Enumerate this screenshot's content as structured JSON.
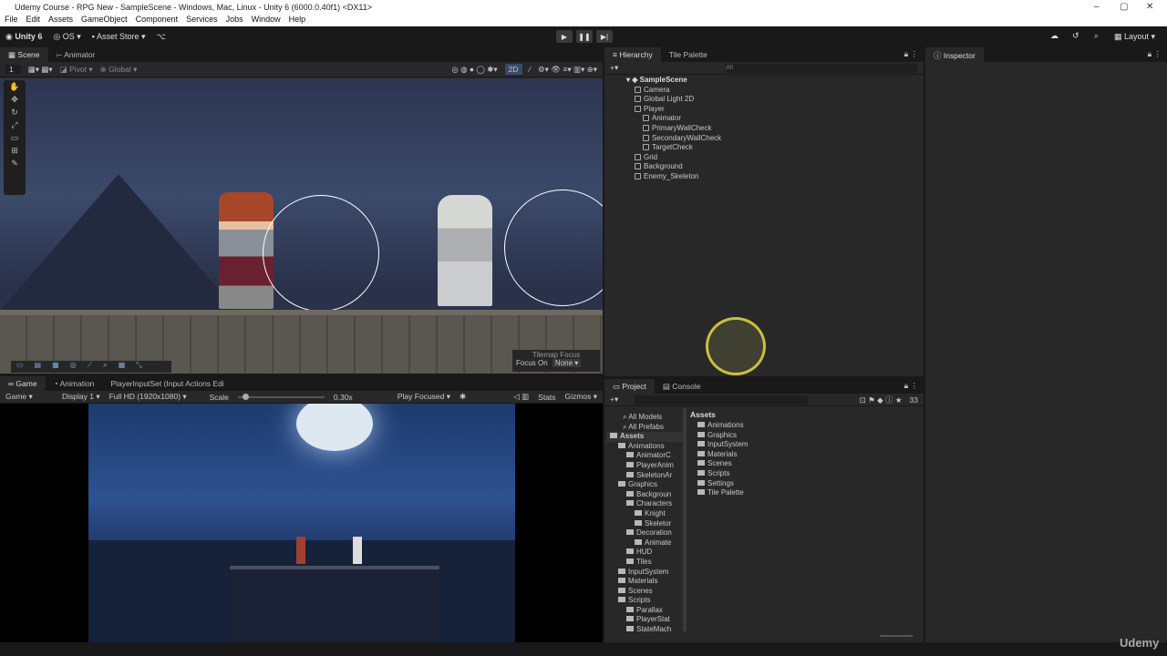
{
  "window": {
    "title": "Udemy Course - RPG New - SampleScene - Windows, Mac, Linux - Unity 6 (6000.0.40f1) <DX11>"
  },
  "menu": [
    "File",
    "Edit",
    "Assets",
    "GameObject",
    "Component",
    "Services",
    "Jobs",
    "Window",
    "Help"
  ],
  "toolbar": {
    "account": "Unity 6",
    "os": "OS",
    "asset_store": "Asset Store",
    "layout": "Layout"
  },
  "scene": {
    "tabs": [
      "Scene",
      "Animator"
    ],
    "layer": "1",
    "pivot": "Pivot",
    "global": "Global",
    "mode2d": "2D",
    "overlay_title": "Tilemap Focus",
    "focus_label": "Focus On",
    "focus_value": "None"
  },
  "game": {
    "tabs": [
      "Game",
      "Animation",
      "PlayerInputSet (Input Actions Edi"
    ],
    "mode": "Game",
    "display": "Display 1",
    "resolution": "Full HD (1920x1080)",
    "scale_label": "Scale",
    "scale_value": "0.30x",
    "scale_fraction": 0.05,
    "play_focused": "Play Focused",
    "stats": "Stats",
    "gizmos": "Gizmos"
  },
  "hierarchy": {
    "tabs": [
      "Hierarchy",
      "Tile Palette"
    ],
    "search_placeholder": "All",
    "scene": "SampleScene",
    "items": [
      {
        "label": "Camera",
        "depth": 1
      },
      {
        "label": "Global Light 2D",
        "depth": 1
      },
      {
        "label": "Player",
        "depth": 1
      },
      {
        "label": "Animator",
        "depth": 2
      },
      {
        "label": "PrimaryWallCheck",
        "depth": 2
      },
      {
        "label": "SecondaryWallCheck",
        "depth": 2
      },
      {
        "label": "TargetCheck",
        "depth": 2
      },
      {
        "label": "Grid",
        "depth": 1
      },
      {
        "label": "Background",
        "depth": 1
      },
      {
        "label": "Enemy_Skeleton",
        "depth": 1
      }
    ]
  },
  "inspector": {
    "tab": "Inspector"
  },
  "project": {
    "tabs": [
      "Project",
      "Console"
    ],
    "hidden_count": "33",
    "breadcrumb": "Assets",
    "tree": [
      {
        "label": "All Models",
        "depth": 0
      },
      {
        "label": "All Prefabs",
        "depth": 0
      },
      {
        "label": "Assets",
        "depth": 0
      },
      {
        "label": "Animations",
        "depth": 1
      },
      {
        "label": "AnimatorC",
        "depth": 2
      },
      {
        "label": "PlayerAnim",
        "depth": 2
      },
      {
        "label": "SkeletonAr",
        "depth": 2
      },
      {
        "label": "Graphics",
        "depth": 1
      },
      {
        "label": "Backgroun",
        "depth": 2
      },
      {
        "label": "Characters",
        "depth": 2
      },
      {
        "label": "Knight",
        "depth": 3
      },
      {
        "label": "Skeletor",
        "depth": 3
      },
      {
        "label": "Decoration",
        "depth": 2
      },
      {
        "label": "Animate",
        "depth": 3
      },
      {
        "label": "HUD",
        "depth": 2
      },
      {
        "label": "Tiles",
        "depth": 2
      },
      {
        "label": "InputSystem",
        "depth": 1
      },
      {
        "label": "Materials",
        "depth": 1
      },
      {
        "label": "Scenes",
        "depth": 1
      },
      {
        "label": "Scripts",
        "depth": 1
      },
      {
        "label": "Parallax",
        "depth": 2
      },
      {
        "label": "PlayerStat",
        "depth": 2
      },
      {
        "label": "StateMach",
        "depth": 2
      }
    ],
    "folders": [
      "Animations",
      "Graphics",
      "InputSystem",
      "Materials",
      "Scenes",
      "Scripts",
      "Settings",
      "Tile Palette"
    ]
  },
  "watermark": "Udemy"
}
